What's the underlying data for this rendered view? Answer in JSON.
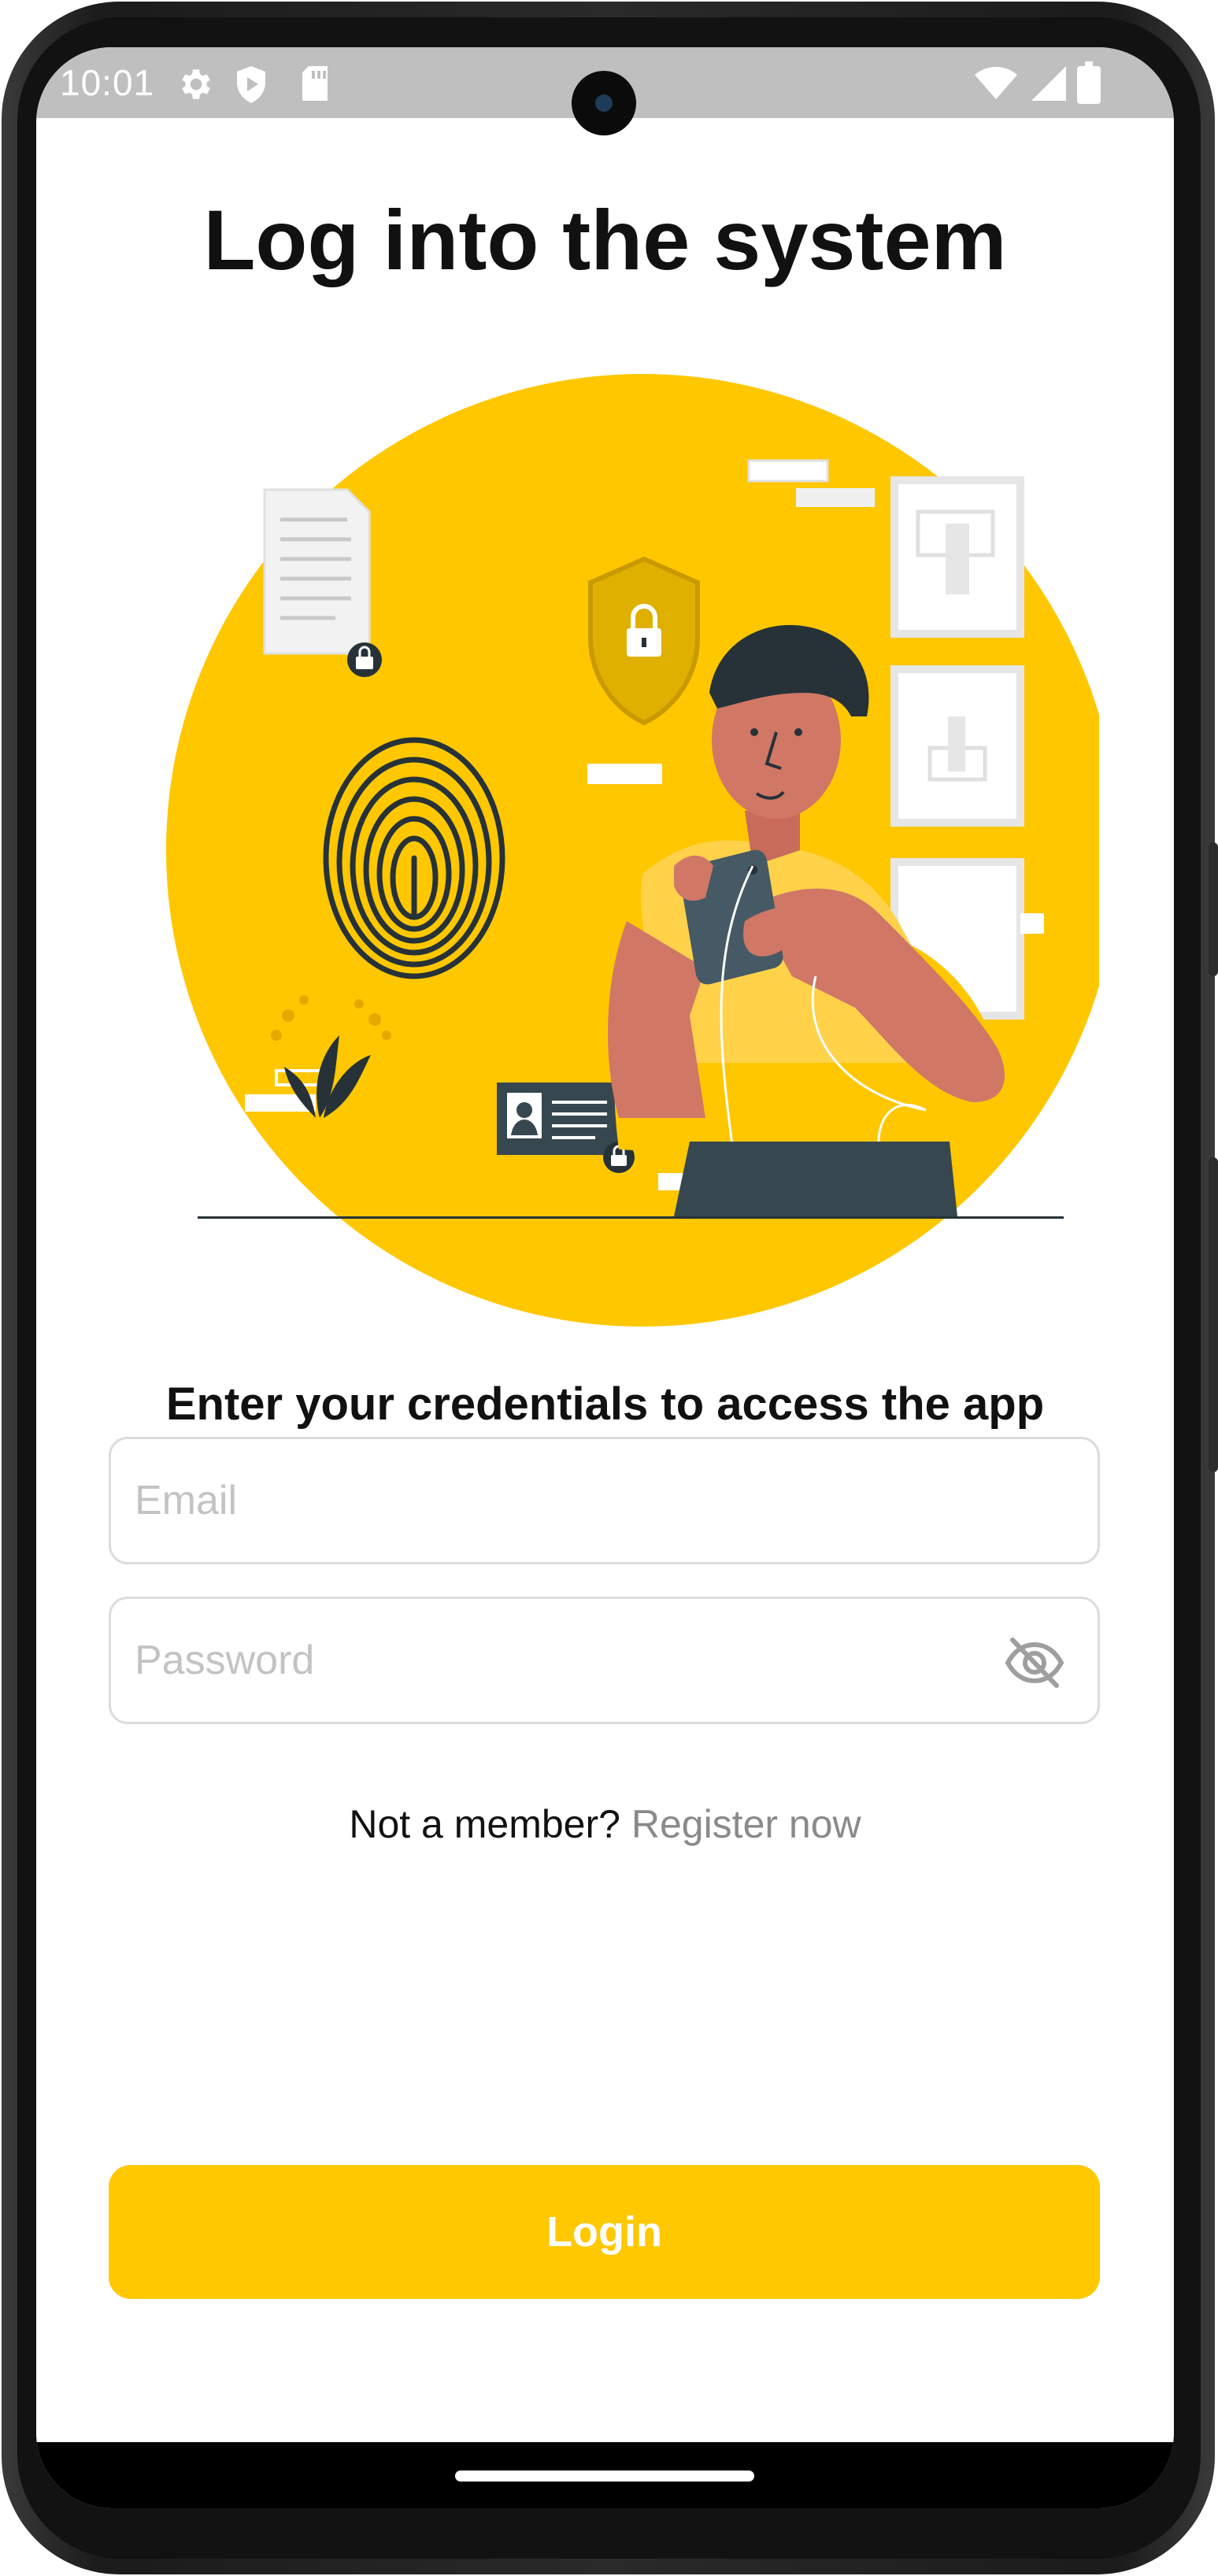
{
  "status_bar": {
    "time": "10:01",
    "icons": [
      "gear-icon",
      "shield-play-icon",
      "sd-card-icon",
      "wifi-icon",
      "signal-icon",
      "battery-icon"
    ]
  },
  "page": {
    "title": "Log into the system",
    "subtitle": "Enter your credentials to access the app"
  },
  "form": {
    "email": {
      "value": "",
      "placeholder": "Email"
    },
    "password": {
      "value": "",
      "placeholder": "Password",
      "toggle_icon": "eye-off-icon"
    }
  },
  "register": {
    "prompt": "Not a member?",
    "link": "Register now"
  },
  "login_button": {
    "label": "Login"
  },
  "colors": {
    "accent": "#FFC800",
    "text": "#111111",
    "placeholder": "#C3C3C3",
    "link": "#8A8A8A",
    "status_bar": "#BFBFBF"
  }
}
